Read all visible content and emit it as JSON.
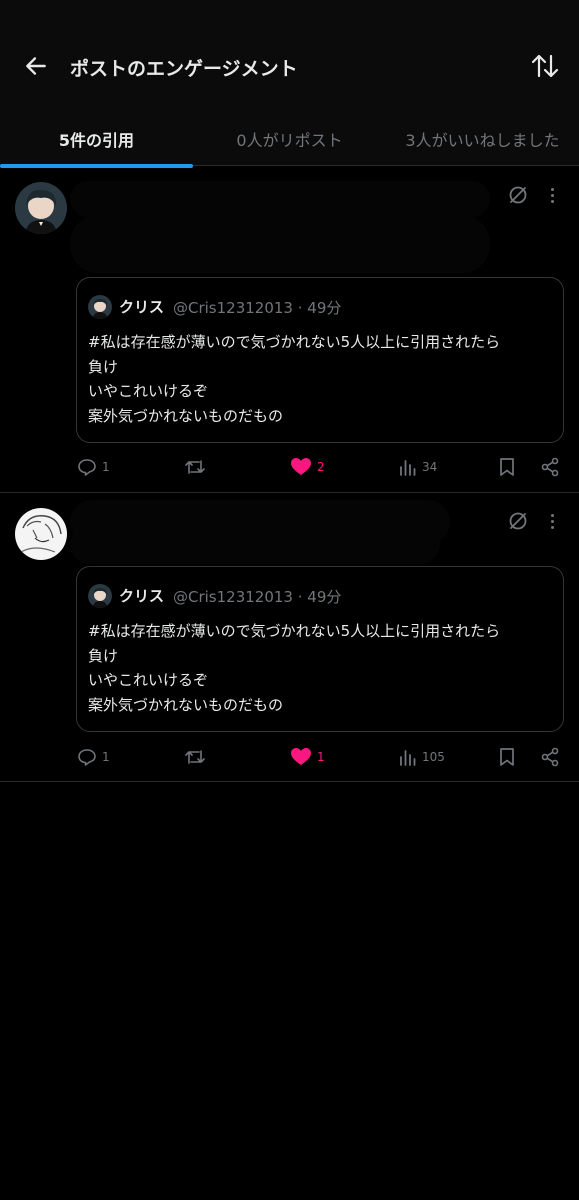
{
  "header": {
    "title": "ポストのエンゲージメント"
  },
  "tabs": [
    {
      "label": "5件の引用",
      "active": true
    },
    {
      "label": "0人がリポスト",
      "active": false
    },
    {
      "label": "3人がいいねしました",
      "active": false
    }
  ],
  "posts": [
    {
      "quote": {
        "name": "クリス",
        "handle": "@Cris12312013 · 49分",
        "text_lines": [
          "#私は存在感が薄いので気づかれない5人以上に引用されたら",
          "負け",
          "いやこれいけるぞ",
          "案外気づかれないものだもの"
        ]
      },
      "actions": {
        "replies": "1",
        "reposts": "",
        "likes": "2",
        "views": "34"
      }
    },
    {
      "quote": {
        "name": "クリス",
        "handle": "@Cris12312013 · 49分",
        "text_lines": [
          "#私は存在感が薄いので気づかれない5人以上に引用されたら",
          "負け",
          "いやこれいけるぞ",
          "案外気づかれないものだもの"
        ]
      },
      "actions": {
        "replies": "1",
        "reposts": "",
        "likes": "1",
        "views": "105"
      }
    }
  ],
  "colors": {
    "background": "#000000",
    "accent": "#1d9bf0",
    "like": "#f91880",
    "muted": "#71767b",
    "text": "#e7e9ea"
  }
}
